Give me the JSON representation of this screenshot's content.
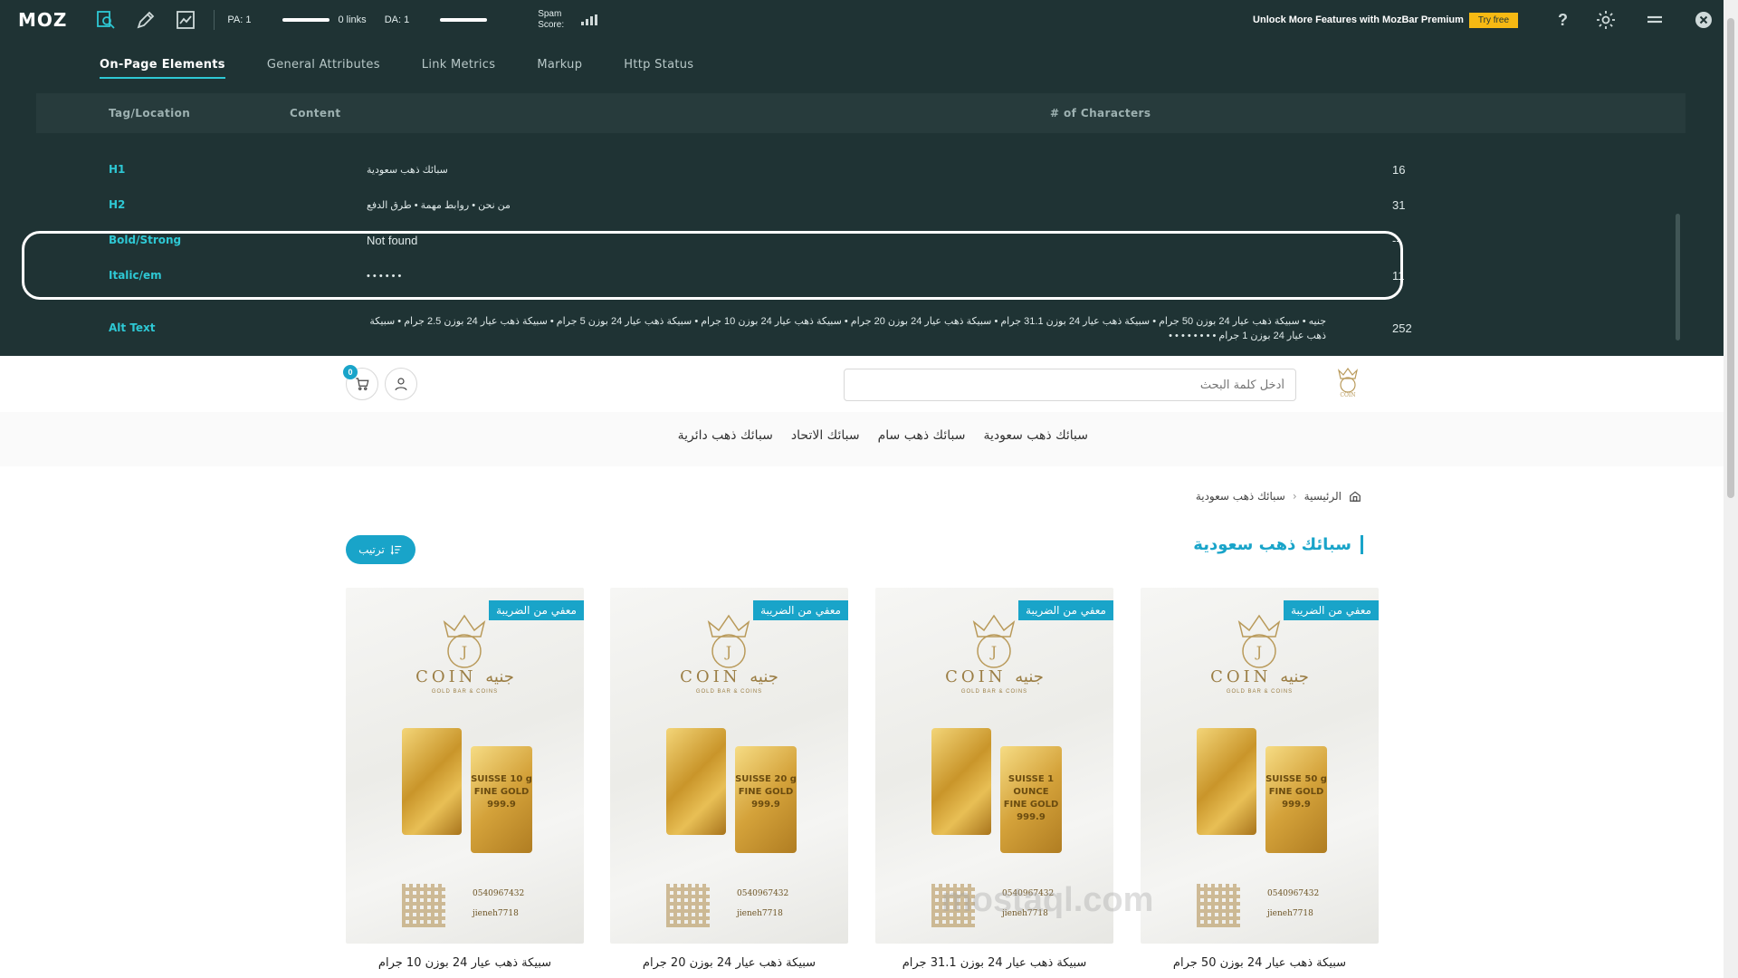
{
  "mozbar": {
    "logo": "MOZ",
    "pa": "PA: 1",
    "links": "0 links",
    "da": "DA: 1",
    "spam_label": "Spam Score:",
    "unlock": "Unlock More Features with MozBar Premium",
    "try_free": "Try free",
    "help": "?"
  },
  "panel": {
    "tabs": [
      "On-Page Elements",
      "General Attributes",
      "Link Metrics",
      "Markup",
      "Http Status"
    ],
    "headers": {
      "tag": "Tag/Location",
      "content": "Content",
      "chars": "# of Characters"
    },
    "rows": [
      {
        "tag": "H1",
        "content": "سبائك ذهب سعودية",
        "count": "16"
      },
      {
        "tag": "H2",
        "content": "من نحن • روابط مهمة • طرق الدفع",
        "count": "31"
      },
      {
        "tag": "Bold/Strong",
        "content": "Not found",
        "count": "--"
      },
      {
        "tag": "Italic/em",
        "content": "• • • • • •",
        "count": "11"
      },
      {
        "tag": "Alt Text",
        "content": "جنيه • سبيكة ذهب عيار 24 بوزن 50 جرام • سبيكة ذهب عيار 24 بوزن 31.1 جرام • سبيكة ذهب عيار 24 بوزن 20 جرام • سبيكة ذهب عيار 24 بوزن 10 جرام • سبيكة ذهب عيار 24 بوزن 5 جرام • سبيكة ذهب عيار 24 بوزن 2.5 جرام • سبيكة ذهب عيار 24 بوزن 1 جرام • • • • • • • •",
        "count": "252"
      }
    ]
  },
  "site": {
    "search_placeholder": "أدخل كلمة البحث",
    "cart_count": "0",
    "logo_text": "COIN",
    "nav": [
      "سبائك ذهب سعودية",
      "سبائك ذهب سام",
      "سبائك الاتحاد",
      "سبائك ذهب دائرية"
    ],
    "breadcrumb": {
      "home": "الرئيسية",
      "current": "سبائك ذهب سعودية"
    },
    "page_title": "سبائك ذهب سعودية",
    "sort_label": "ترتيب",
    "accent_color": "#19a4c9",
    "products": [
      {
        "title": "سبيكة ذهب عيار 24 بوزن 50 جرام",
        "badge": "معفي من الضريبة",
        "bar_text": "SUISSE 50 g FINE GOLD 999.9",
        "phone": "0540967432",
        "handle": "jieneh7718"
      },
      {
        "title": "سبيكة ذهب عيار 24 بوزن 31.1 جرام",
        "badge": "معفي من الضريبة",
        "bar_text": "SUISSE 1 OUNCE FINE GOLD 999.9",
        "phone": "0540967432",
        "handle": "jieneh7718"
      },
      {
        "title": "سبيكة ذهب عيار 24 بوزن 20 جرام",
        "badge": "معفي من الضريبة",
        "bar_text": "SUISSE 20 g FINE GOLD 999.9",
        "phone": "0540967432",
        "handle": "jieneh7718"
      },
      {
        "title": "سبيكة ذهب عيار 24 بوزن 10 جرام",
        "badge": "معفي من الضريبة",
        "bar_text": "SUISSE 10 g FINE GOLD 999.9",
        "phone": "0540967432",
        "handle": "jieneh7718"
      }
    ],
    "card_brand": "COIN جنيه",
    "card_brand_sub": "GOLD BAR & COINS",
    "watermark": "mostaql.com"
  }
}
